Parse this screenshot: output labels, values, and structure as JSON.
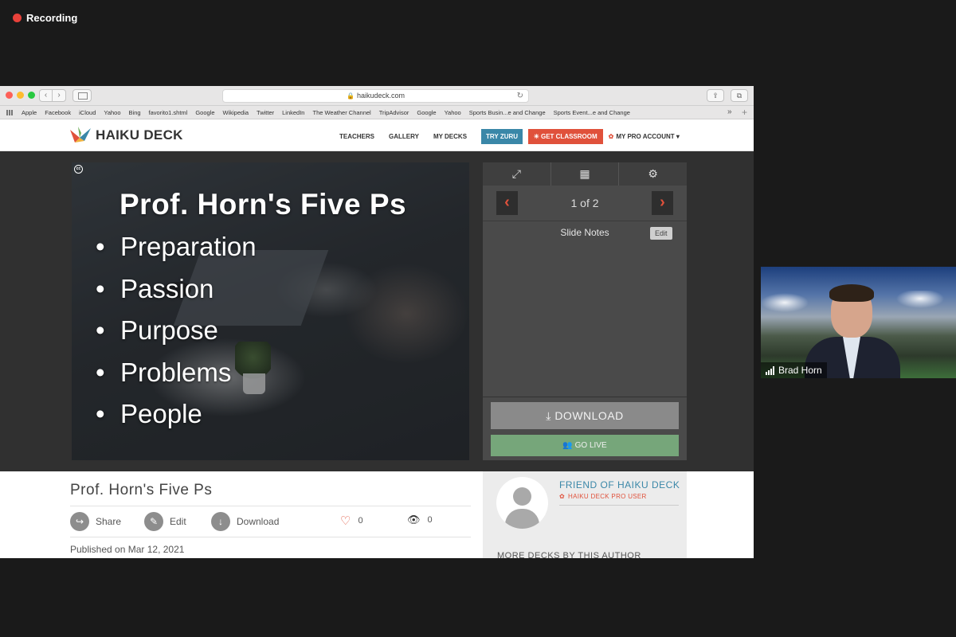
{
  "recording": {
    "label": "Recording"
  },
  "browser": {
    "url": "haikudeck.com",
    "favorites": [
      "Apple",
      "Facebook",
      "iCloud",
      "Yahoo",
      "Bing",
      "favorito1.shtml",
      "Google",
      "Wikipedia",
      "Twitter",
      "LinkedIn",
      "The Weather Channel",
      "TripAdvisor",
      "Google",
      "Yahoo",
      "Sports Busin...e and Change",
      "Sports Event...e and Change"
    ]
  },
  "site": {
    "logo": "HAIKU DECK",
    "nav": {
      "teachers": "TEACHERS",
      "gallery": "GALLERY",
      "my_decks": "MY DECKS",
      "try_zuru": "TRY ZURU",
      "get_classroom": "GET CLASSROOM",
      "pro_account": "MY PRO ACCOUNT ▾"
    }
  },
  "slide": {
    "title": "Prof. Horn's Five Ps",
    "bullets": [
      "Preparation",
      "Passion",
      "Purpose",
      "Problems",
      "People"
    ],
    "cc": "cc"
  },
  "panel": {
    "pager": "1 of 2",
    "notes_title": "Slide Notes",
    "edit": "Edit",
    "download": "DOWNLOAD",
    "go_live": "GO LIVE"
  },
  "deck": {
    "title": "Prof. Horn's Five Ps",
    "share": "Share",
    "edit": "Edit",
    "download": "Download",
    "likes": "0",
    "views": "0",
    "published": "Published on Mar 12, 2021"
  },
  "author": {
    "name": "FRIEND OF HAIKU DECK",
    "badge": "HAIKU DECK PRO USER",
    "more": "MORE DECKS BY THIS AUTHOR"
  },
  "participant": {
    "name": "Brad Horn"
  },
  "colors": {
    "accent": "#e0513b",
    "teal": "#3a87a8",
    "go_live": "#76a67a",
    "recording": "#e8413a"
  }
}
